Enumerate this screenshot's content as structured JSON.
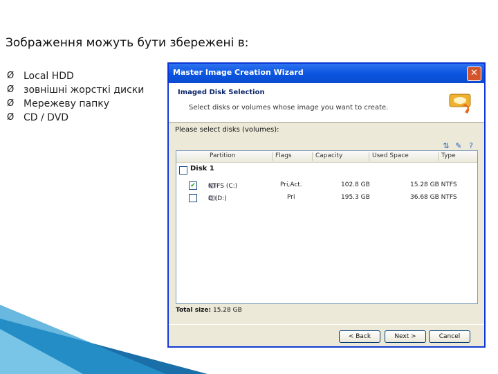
{
  "slide": {
    "title": "Зображення можуть бути збережені в:",
    "bullets": [
      "Local HDD",
      "зовнішні жорсткі диски",
      "Мережеву папку",
      "CD / DVD"
    ],
    "bullet_glyph": "Ø"
  },
  "window": {
    "title": "Master Image Creation Wizard",
    "close_label": "✕",
    "header_title": "Imaged Disk Selection",
    "header_subtitle": "Select disks or volumes whose image you want to create.",
    "prompt": "Please select disks (volumes):",
    "columns": [
      "Partition",
      "Flags",
      "Capacity",
      "Used Space",
      "Type"
    ],
    "disk_label": "Disk 1",
    "rows": [
      {
        "checked": true,
        "partition": "NTFS (C:)",
        "flags": "Pri,Act.",
        "capacity": "102.8 GB",
        "used": "15.28 GB NTFS"
      },
      {
        "checked": false,
        "partition": "D (D:)",
        "flags": "Pri",
        "capacity": "195.3 GB",
        "used": "36.68 GB NTFS"
      }
    ],
    "total_label": "Total size:",
    "total_value": "15.28 GB",
    "buttons": {
      "back": "< Back",
      "next": "Next >",
      "cancel": "Cancel"
    },
    "colors": {
      "titlebar": "#0b56e0",
      "accent": "#0a246a",
      "close": "#d3542d"
    }
  }
}
